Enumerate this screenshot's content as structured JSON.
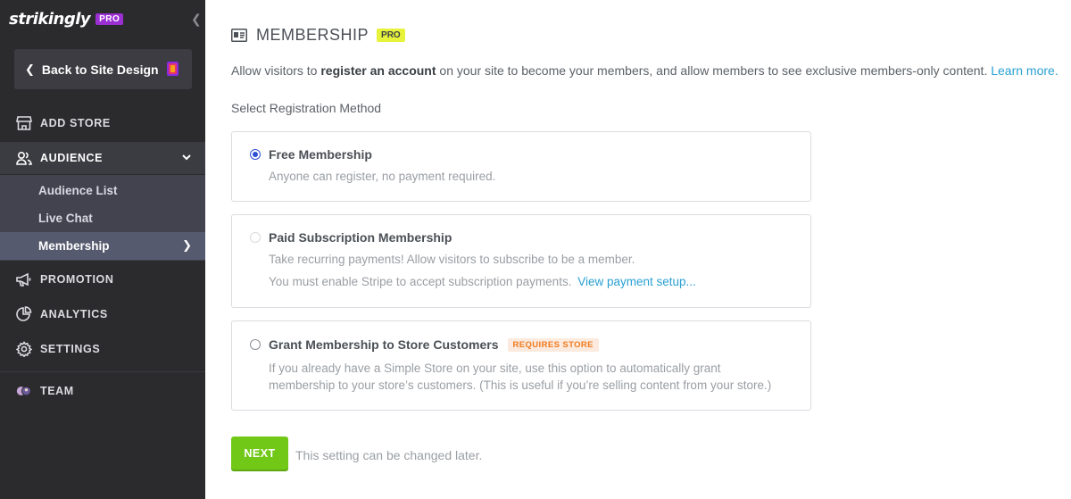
{
  "sidebar": {
    "brand": "strikingly",
    "brand_badge": "PRO",
    "back_label": "Back to Site Design",
    "nav": {
      "add_store": "ADD STORE",
      "audience": "AUDIENCE",
      "promotion": "PROMOTION",
      "analytics": "ANALYTICS",
      "settings": "SETTINGS",
      "team": "TEAM"
    },
    "audience_sub": [
      "Audience List",
      "Live Chat",
      "Membership"
    ]
  },
  "main": {
    "title": "MEMBERSHIP",
    "title_badge": "PRO",
    "intro_prefix": "Allow visitors to ",
    "intro_bold": "register an account",
    "intro_suffix": " on your site to become your members, and allow members to see exclusive members-only content. ",
    "intro_link": "Learn more.",
    "select_label": "Select Registration Method",
    "options": [
      {
        "title": "Free Membership",
        "desc": "Anyone can register, no payment required.",
        "state": "selected"
      },
      {
        "title": "Paid Subscription Membership",
        "desc1": "Take recurring payments! Allow visitors to subscribe to be a member.",
        "desc2": "You must enable Stripe to accept subscription payments.",
        "link": "View payment setup...",
        "state": "disabled"
      },
      {
        "title": "Grant Membership to Store Customers",
        "badge": "REQUIRES STORE",
        "desc1": "If you already have a Simple Store on your site, use this option to automatically grant",
        "desc2": "membership to your store’s customers. (This is useful if you’re selling content from your store.)",
        "state": "unselected"
      }
    ],
    "next_label": "NEXT",
    "next_note": "This setting can be changed later."
  },
  "colors": {
    "sidebar_bg": "#2b2b2e",
    "accent_green": "#71c816",
    "link_blue": "#2aa0d3",
    "pro_purple": "#9b2fd1",
    "pro_yellow": "#e7f23a",
    "radio_blue": "#2f4fd6",
    "requires_store_orange": "#f07b21"
  },
  "icons": {
    "collapse": "chevron-left-icon",
    "back": "chevron-left-icon",
    "theme": "paint-swatch-icon",
    "add_store": "storefront-icon",
    "audience": "users-icon",
    "audience_caret": "chevron-down-icon",
    "membership_arrow": "chevron-right-icon",
    "promotion": "megaphone-icon",
    "analytics": "pie-chart-icon",
    "settings": "gear-icon",
    "team": "team-avatars-icon",
    "title": "id-card-icon"
  }
}
